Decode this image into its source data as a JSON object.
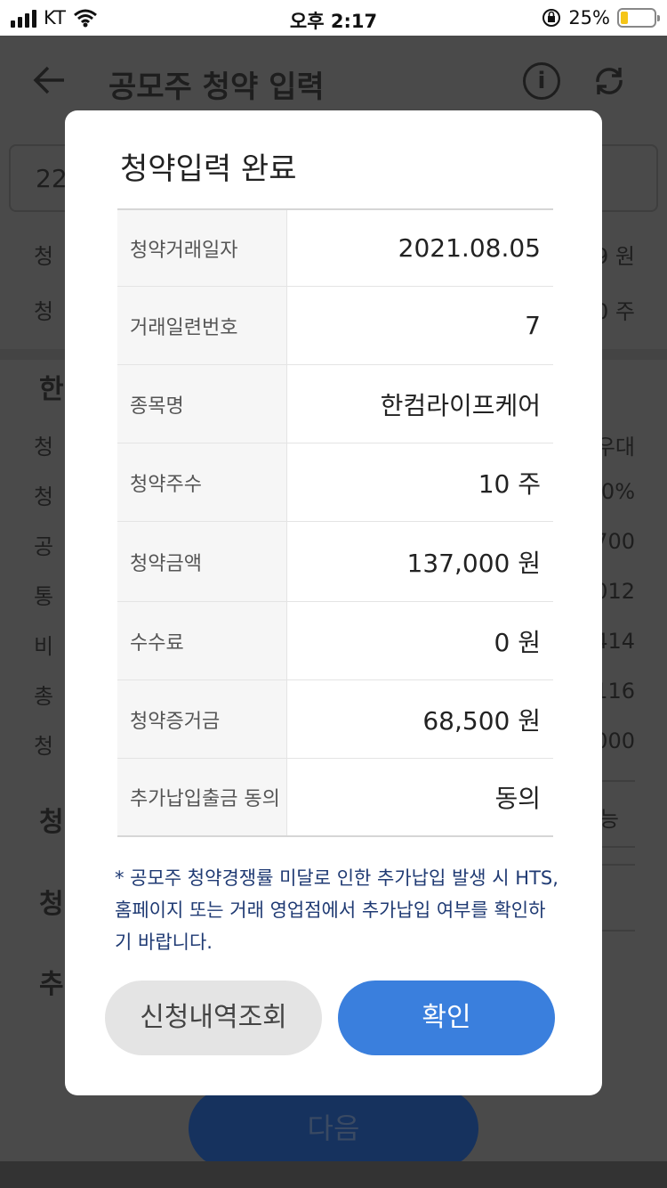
{
  "status_bar": {
    "carrier": "KT",
    "time": "오후 2:17",
    "battery_pct": "25%"
  },
  "background": {
    "title": "공모주 청약 입력",
    "box_prefix": "22",
    "rows": [
      {
        "l": "청",
        "r": "9 원"
      },
      {
        "l": "청",
        "r": "0 주"
      },
      {
        "l": "청",
        "r": "우대"
      },
      {
        "l": "청",
        "r": "0%"
      },
      {
        "l": "공",
        "r": "700"
      },
      {
        "l": "통",
        "r": "012"
      },
      {
        "l": "비",
        "r": "414"
      },
      {
        "l": "총",
        "r": "116"
      },
      {
        "l": "청",
        "r": "000"
      }
    ],
    "section_head": "한",
    "labels": [
      "청",
      "청",
      "추"
    ],
    "pill_text": "능",
    "next_label": "다음"
  },
  "modal": {
    "title": "청약입력 완료",
    "rows": [
      {
        "label": "청약거래일자",
        "value": "2021.08.05"
      },
      {
        "label": "거래일련번호",
        "value": "7"
      },
      {
        "label": "종목명",
        "value": "한컴라이프케어"
      },
      {
        "label": "청약주수",
        "value": "10 주"
      },
      {
        "label": "청약금액",
        "value": "137,000 원"
      },
      {
        "label": "수수료",
        "value": "0 원"
      },
      {
        "label": "청약증거금",
        "value": "68,500 원"
      },
      {
        "label": "추가납입출금 동의",
        "value": "동의"
      }
    ],
    "notice": "* 공모주 청약경쟁률 미달로 인한 추가납입 발생 시 HTS, 홈페이지 또는 거래 영업점에서 추가납입 여부를 확인하기 바랍니다.",
    "history_button": "신청내역조회",
    "confirm_button": "확인"
  },
  "colors": {
    "accent": "#3a7fdd",
    "notice_text": "#1f3a73",
    "overlay": "#4a4a4a"
  }
}
